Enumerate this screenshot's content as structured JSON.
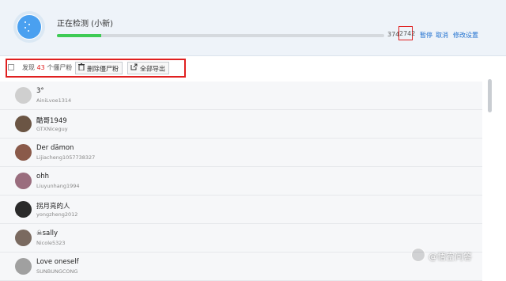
{
  "header": {
    "title": "正在检测 (小新)",
    "progress_fraction": 0.136,
    "done_count": "374",
    "total_count": "2742",
    "pause_label": "暂停",
    "cancel_label": "取消",
    "settings_label": "修改设置",
    "accent_color": "#1e6fcf",
    "progress_color": "#3ecb55",
    "highlight_color": "#e02020"
  },
  "toolbar": {
    "found_prefix": "发现",
    "found_count": "43",
    "found_suffix": "个僵尸粉",
    "delete_label": "删除僵尸粉",
    "export_label": "全部导出"
  },
  "list": [
    {
      "nickname": "3°",
      "uid": "AiniLvoe1314",
      "avatar_color": "#cfcfcf"
    },
    {
      "nickname": "酷哥1949",
      "uid": "GTXNiceguy",
      "avatar_color": "#6b5544"
    },
    {
      "nickname": "Der dämon",
      "uid": "Lijiacheng1057738327",
      "avatar_color": "#8a5a4a"
    },
    {
      "nickname": "ohh",
      "uid": "Liuyunhang1994",
      "avatar_color": "#9a6d7e"
    },
    {
      "nickname": "拐月亮的人",
      "uid": "yongzheng2012",
      "avatar_color": "#2a2a2a"
    },
    {
      "nickname": "☠sally",
      "uid": "Nicole5323",
      "avatar_color": "#7a6a60"
    },
    {
      "nickname": "Love oneself",
      "uid": "SUNBUNGCONG",
      "avatar_color": "#a0a0a0"
    }
  ],
  "watermark": {
    "text": "@悟空问答",
    "color": "#ffffff"
  }
}
